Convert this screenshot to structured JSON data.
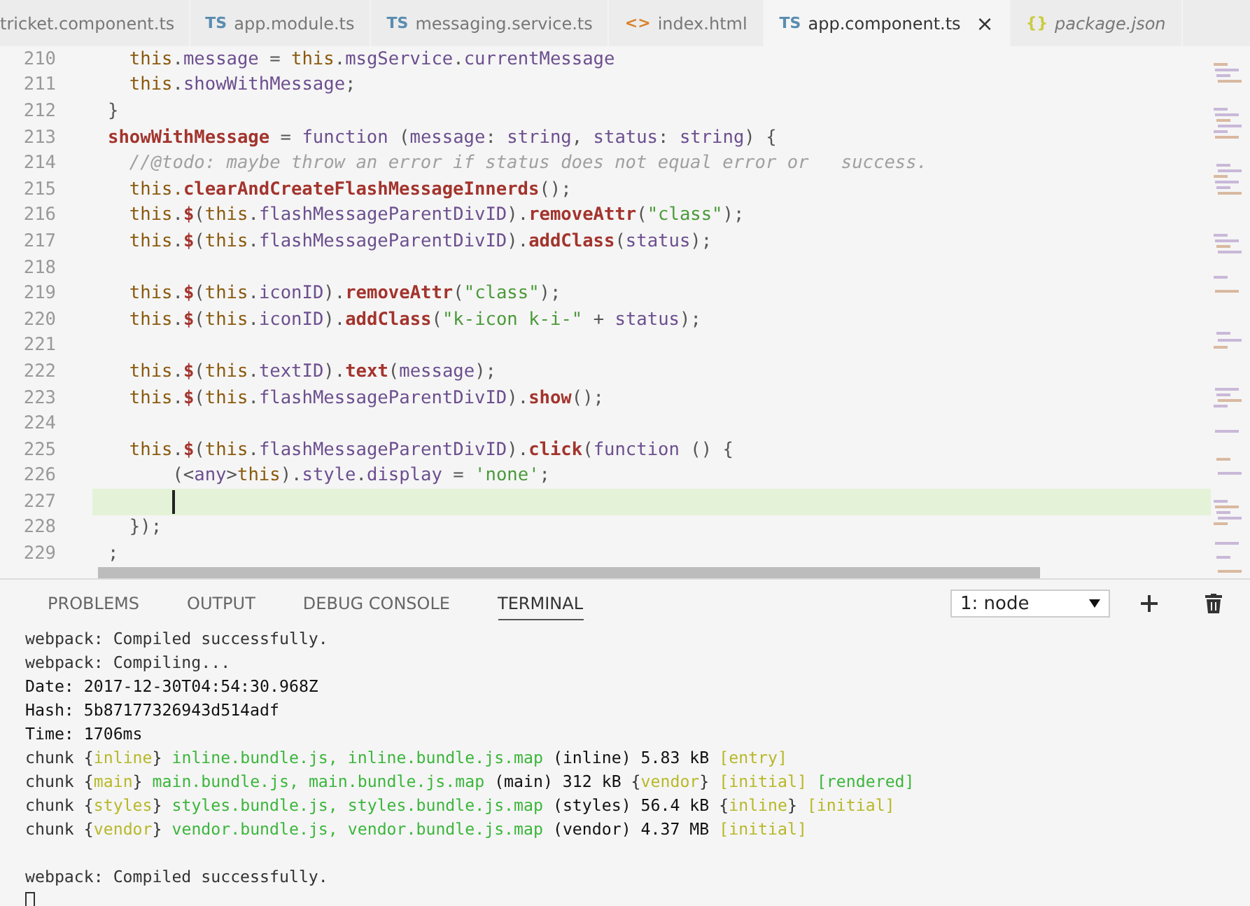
{
  "tabs": [
    {
      "label": "tricket.component.ts",
      "selected": false,
      "preview": false
    },
    {
      "badge": "TS",
      "kind": "ts",
      "label": "app.module.ts",
      "selected": false,
      "preview": false
    },
    {
      "badge": "TS",
      "kind": "ts",
      "label": "messaging.service.ts",
      "selected": false,
      "preview": false
    },
    {
      "badge": "<>",
      "kind": "html",
      "label": "index.html",
      "selected": false,
      "preview": false
    },
    {
      "badge": "TS",
      "kind": "ts",
      "label": "app.component.ts",
      "selected": true,
      "preview": false,
      "close": "×"
    },
    {
      "badge": "{}",
      "kind": "json",
      "label": "package.json",
      "selected": false,
      "preview": true
    }
  ],
  "editor": {
    "lines": [
      {
        "number": "210",
        "current": false,
        "segments": [
          {
            "kind": "kw",
            "text": "  this"
          },
          {
            "kind": "p",
            "text": "."
          },
          {
            "kind": "prop",
            "text": "message"
          },
          {
            "kind": "p",
            "text": " = "
          },
          {
            "kind": "kw",
            "text": "this"
          },
          {
            "kind": "p",
            "text": "."
          },
          {
            "kind": "prop",
            "text": "msgService"
          },
          {
            "kind": "p",
            "text": "."
          },
          {
            "kind": "prop",
            "text": "currentMessage"
          }
        ]
      },
      {
        "number": "211",
        "current": false,
        "segments": [
          {
            "kind": "kw",
            "text": "  this"
          },
          {
            "kind": "p",
            "text": "."
          },
          {
            "kind": "prop",
            "text": "showWithMessage"
          },
          {
            "kind": "p",
            "text": ";"
          }
        ]
      },
      {
        "number": "212",
        "current": false,
        "segments": [
          {
            "kind": "p",
            "text": "}"
          }
        ]
      },
      {
        "number": "213",
        "current": false,
        "segments": [
          {
            "kind": "fn",
            "text": "showWithMessage"
          },
          {
            "kind": "p",
            "text": " = "
          },
          {
            "kind": "prop",
            "text": "function"
          },
          {
            "kind": "p",
            "text": " ("
          },
          {
            "kind": "prop",
            "text": "message"
          },
          {
            "kind": "p",
            "text": ": "
          },
          {
            "kind": "prop",
            "text": "string"
          },
          {
            "kind": "p",
            "text": ", "
          },
          {
            "kind": "prop",
            "text": "status"
          },
          {
            "kind": "p",
            "text": ": "
          },
          {
            "kind": "prop",
            "text": "string"
          },
          {
            "kind": "p",
            "text": ") {"
          }
        ]
      },
      {
        "number": "214",
        "current": false,
        "segments": [
          {
            "kind": "cm",
            "text": "  //@todo: maybe throw an error if status does not equal error or   success."
          }
        ]
      },
      {
        "number": "215",
        "current": false,
        "segments": [
          {
            "kind": "kw",
            "text": "  this."
          },
          {
            "kind": "fn",
            "text": "clearAndCreateFlashMessageInnerds"
          },
          {
            "kind": "p",
            "text": "();"
          }
        ]
      },
      {
        "number": "216",
        "current": false,
        "segments": [
          {
            "kind": "kw",
            "text": "  this"
          },
          {
            "kind": "p",
            "text": "."
          },
          {
            "kind": "fn",
            "text": "$"
          },
          {
            "kind": "p",
            "text": "("
          },
          {
            "kind": "kw",
            "text": "this"
          },
          {
            "kind": "p",
            "text": "."
          },
          {
            "kind": "prop",
            "text": "flashMessageParentDivID"
          },
          {
            "kind": "p",
            "text": ")."
          },
          {
            "kind": "fn",
            "text": "removeAttr"
          },
          {
            "kind": "p",
            "text": "("
          },
          {
            "kind": "str",
            "text": "\"class\""
          },
          {
            "kind": "p",
            "text": ");"
          }
        ]
      },
      {
        "number": "217",
        "current": false,
        "segments": [
          {
            "kind": "kw",
            "text": "  this"
          },
          {
            "kind": "p",
            "text": "."
          },
          {
            "kind": "fn",
            "text": "$"
          },
          {
            "kind": "p",
            "text": "("
          },
          {
            "kind": "kw",
            "text": "this"
          },
          {
            "kind": "p",
            "text": "."
          },
          {
            "kind": "prop",
            "text": "flashMessageParentDivID"
          },
          {
            "kind": "p",
            "text": ")."
          },
          {
            "kind": "fn",
            "text": "addClass"
          },
          {
            "kind": "p",
            "text": "("
          },
          {
            "kind": "prop",
            "text": "status"
          },
          {
            "kind": "p",
            "text": ");"
          }
        ]
      },
      {
        "number": "218",
        "current": false
      },
      {
        "number": "219",
        "current": false,
        "segments": [
          {
            "kind": "kw",
            "text": "  this"
          },
          {
            "kind": "p",
            "text": "."
          },
          {
            "kind": "fn",
            "text": "$"
          },
          {
            "kind": "p",
            "text": "("
          },
          {
            "kind": "kw",
            "text": "this"
          },
          {
            "kind": "p",
            "text": "."
          },
          {
            "kind": "prop",
            "text": "iconID"
          },
          {
            "kind": "p",
            "text": ")."
          },
          {
            "kind": "fn",
            "text": "removeAttr"
          },
          {
            "kind": "p",
            "text": "("
          },
          {
            "kind": "str",
            "text": "\"class\""
          },
          {
            "kind": "p",
            "text": ");"
          }
        ]
      },
      {
        "number": "220",
        "current": false,
        "segments": [
          {
            "kind": "kw",
            "text": "  this"
          },
          {
            "kind": "p",
            "text": "."
          },
          {
            "kind": "fn",
            "text": "$"
          },
          {
            "kind": "p",
            "text": "("
          },
          {
            "kind": "kw",
            "text": "this"
          },
          {
            "kind": "p",
            "text": "."
          },
          {
            "kind": "prop",
            "text": "iconID"
          },
          {
            "kind": "p",
            "text": ")."
          },
          {
            "kind": "fn",
            "text": "addClass"
          },
          {
            "kind": "p",
            "text": "("
          },
          {
            "kind": "str",
            "text": "\"k-icon k-i-\""
          },
          {
            "kind": "p",
            "text": " + "
          },
          {
            "kind": "prop",
            "text": "status"
          },
          {
            "kind": "p",
            "text": ");"
          }
        ]
      },
      {
        "number": "221",
        "current": false
      },
      {
        "number": "222",
        "current": false,
        "segments": [
          {
            "kind": "kw",
            "text": "  this"
          },
          {
            "kind": "p",
            "text": "."
          },
          {
            "kind": "fn",
            "text": "$"
          },
          {
            "kind": "p",
            "text": "("
          },
          {
            "kind": "kw",
            "text": "this"
          },
          {
            "kind": "p",
            "text": "."
          },
          {
            "kind": "prop",
            "text": "textID"
          },
          {
            "kind": "p",
            "text": ")."
          },
          {
            "kind": "fn",
            "text": "text"
          },
          {
            "kind": "p",
            "text": "("
          },
          {
            "kind": "prop",
            "text": "message"
          },
          {
            "kind": "p",
            "text": ");"
          }
        ]
      },
      {
        "number": "223",
        "current": false,
        "segments": [
          {
            "kind": "kw",
            "text": "  this"
          },
          {
            "kind": "p",
            "text": "."
          },
          {
            "kind": "fn",
            "text": "$"
          },
          {
            "kind": "p",
            "text": "("
          },
          {
            "kind": "kw",
            "text": "this"
          },
          {
            "kind": "p",
            "text": "."
          },
          {
            "kind": "prop",
            "text": "flashMessageParentDivID"
          },
          {
            "kind": "p",
            "text": ")."
          },
          {
            "kind": "fn",
            "text": "show"
          },
          {
            "kind": "p",
            "text": "();"
          }
        ]
      },
      {
        "number": "224",
        "current": false
      },
      {
        "number": "225",
        "current": false,
        "segments": [
          {
            "kind": "kw",
            "text": "  this"
          },
          {
            "kind": "p",
            "text": "."
          },
          {
            "kind": "fn",
            "text": "$"
          },
          {
            "kind": "p",
            "text": "("
          },
          {
            "kind": "kw",
            "text": "this"
          },
          {
            "kind": "p",
            "text": "."
          },
          {
            "kind": "prop",
            "text": "flashMessageParentDivID"
          },
          {
            "kind": "p",
            "text": ")."
          },
          {
            "kind": "fn",
            "text": "click"
          },
          {
            "kind": "p",
            "text": "("
          },
          {
            "kind": "prop",
            "text": "function"
          },
          {
            "kind": "p",
            "text": " () {"
          }
        ]
      },
      {
        "number": "226",
        "current": false,
        "segments": [
          {
            "kind": "p",
            "text": "      (<"
          },
          {
            "kind": "prop",
            "text": "any"
          },
          {
            "kind": "p",
            "text": ">"
          },
          {
            "kind": "kw",
            "text": "this"
          },
          {
            "kind": "p",
            "text": ")."
          },
          {
            "kind": "prop",
            "text": "style"
          },
          {
            "kind": "p",
            "text": "."
          },
          {
            "kind": "prop",
            "text": "display"
          },
          {
            "kind": "p",
            "text": " = "
          },
          {
            "kind": "str",
            "text": "'none'"
          },
          {
            "kind": "p",
            "text": ";"
          }
        ]
      },
      {
        "number": "227",
        "current": true
      },
      {
        "number": "228",
        "current": false,
        "segments": [
          {
            "kind": "p",
            "text": "  });"
          }
        ]
      },
      {
        "number": "229",
        "current": false,
        "segments": [
          {
            "kind": "p",
            "text": ";"
          }
        ]
      }
    ]
  },
  "panel": {
    "tabs": [
      {
        "label": "PROBLEMS",
        "selected": false
      },
      {
        "label": "OUTPUT",
        "selected": false
      },
      {
        "label": "DEBUG CONSOLE",
        "selected": false
      },
      {
        "label": "TERMINAL",
        "selected": true
      }
    ],
    "terminal_select": "1: node",
    "terminal_lines": [
      {
        "segments": [
          {
            "kind": "p",
            "text": "webpack: Compiled successfully."
          }
        ]
      },
      {
        "segments": [
          {
            "kind": "p",
            "text": "webpack: Compiling..."
          }
        ]
      },
      {
        "segments": [
          {
            "kind": "b",
            "text": "Date: 2017-12-30T04:54:30.968Z"
          }
        ]
      },
      {
        "segments": [
          {
            "kind": "b",
            "text": "Hash: 5b87177326943d514adf"
          }
        ]
      },
      {
        "segments": [
          {
            "kind": "b",
            "text": "Time: 1706ms"
          }
        ]
      },
      {
        "segments": [
          {
            "kind": "p",
            "text": "chunk {"
          },
          {
            "kind": "y",
            "text": "inline"
          },
          {
            "kind": "p",
            "text": "} "
          },
          {
            "kind": "g",
            "text": "inline.bundle.js, inline.bundle.js.map"
          },
          {
            "kind": "b",
            "text": " (inline) 5.83 kB "
          },
          {
            "kind": "y",
            "text": "[entry]"
          }
        ]
      },
      {
        "segments": [
          {
            "kind": "p",
            "text": "chunk {"
          },
          {
            "kind": "y",
            "text": "main"
          },
          {
            "kind": "p",
            "text": "} "
          },
          {
            "kind": "g",
            "text": "main.bundle.js, main.bundle.js.map"
          },
          {
            "kind": "b",
            "text": " (main) 312 kB "
          },
          {
            "kind": "p",
            "text": "{"
          },
          {
            "kind": "y",
            "text": "vendor"
          },
          {
            "kind": "p",
            "text": "} "
          },
          {
            "kind": "y",
            "text": "[initial] "
          },
          {
            "kind": "g",
            "text": "[rendered]"
          }
        ]
      },
      {
        "segments": [
          {
            "kind": "p",
            "text": "chunk {"
          },
          {
            "kind": "y",
            "text": "styles"
          },
          {
            "kind": "p",
            "text": "} "
          },
          {
            "kind": "g",
            "text": "styles.bundle.js, styles.bundle.js.map"
          },
          {
            "kind": "b",
            "text": " (styles) 56.4 kB "
          },
          {
            "kind": "p",
            "text": "{"
          },
          {
            "kind": "y",
            "text": "inline"
          },
          {
            "kind": "p",
            "text": "} "
          },
          {
            "kind": "y",
            "text": "[initial]"
          }
        ]
      },
      {
        "segments": [
          {
            "kind": "p",
            "text": "chunk {"
          },
          {
            "kind": "y",
            "text": "vendor"
          },
          {
            "kind": "p",
            "text": "} "
          },
          {
            "kind": "g",
            "text": "vendor.bundle.js, vendor.bundle.js.map"
          },
          {
            "kind": "b",
            "text": " (vendor) 4.37 MB "
          },
          {
            "kind": "y",
            "text": "[initial]"
          }
        ]
      },
      {
        "segments": [
          {
            "kind": "p",
            "text": "webpack: Compiled successfully."
          }
        ]
      }
    ]
  }
}
